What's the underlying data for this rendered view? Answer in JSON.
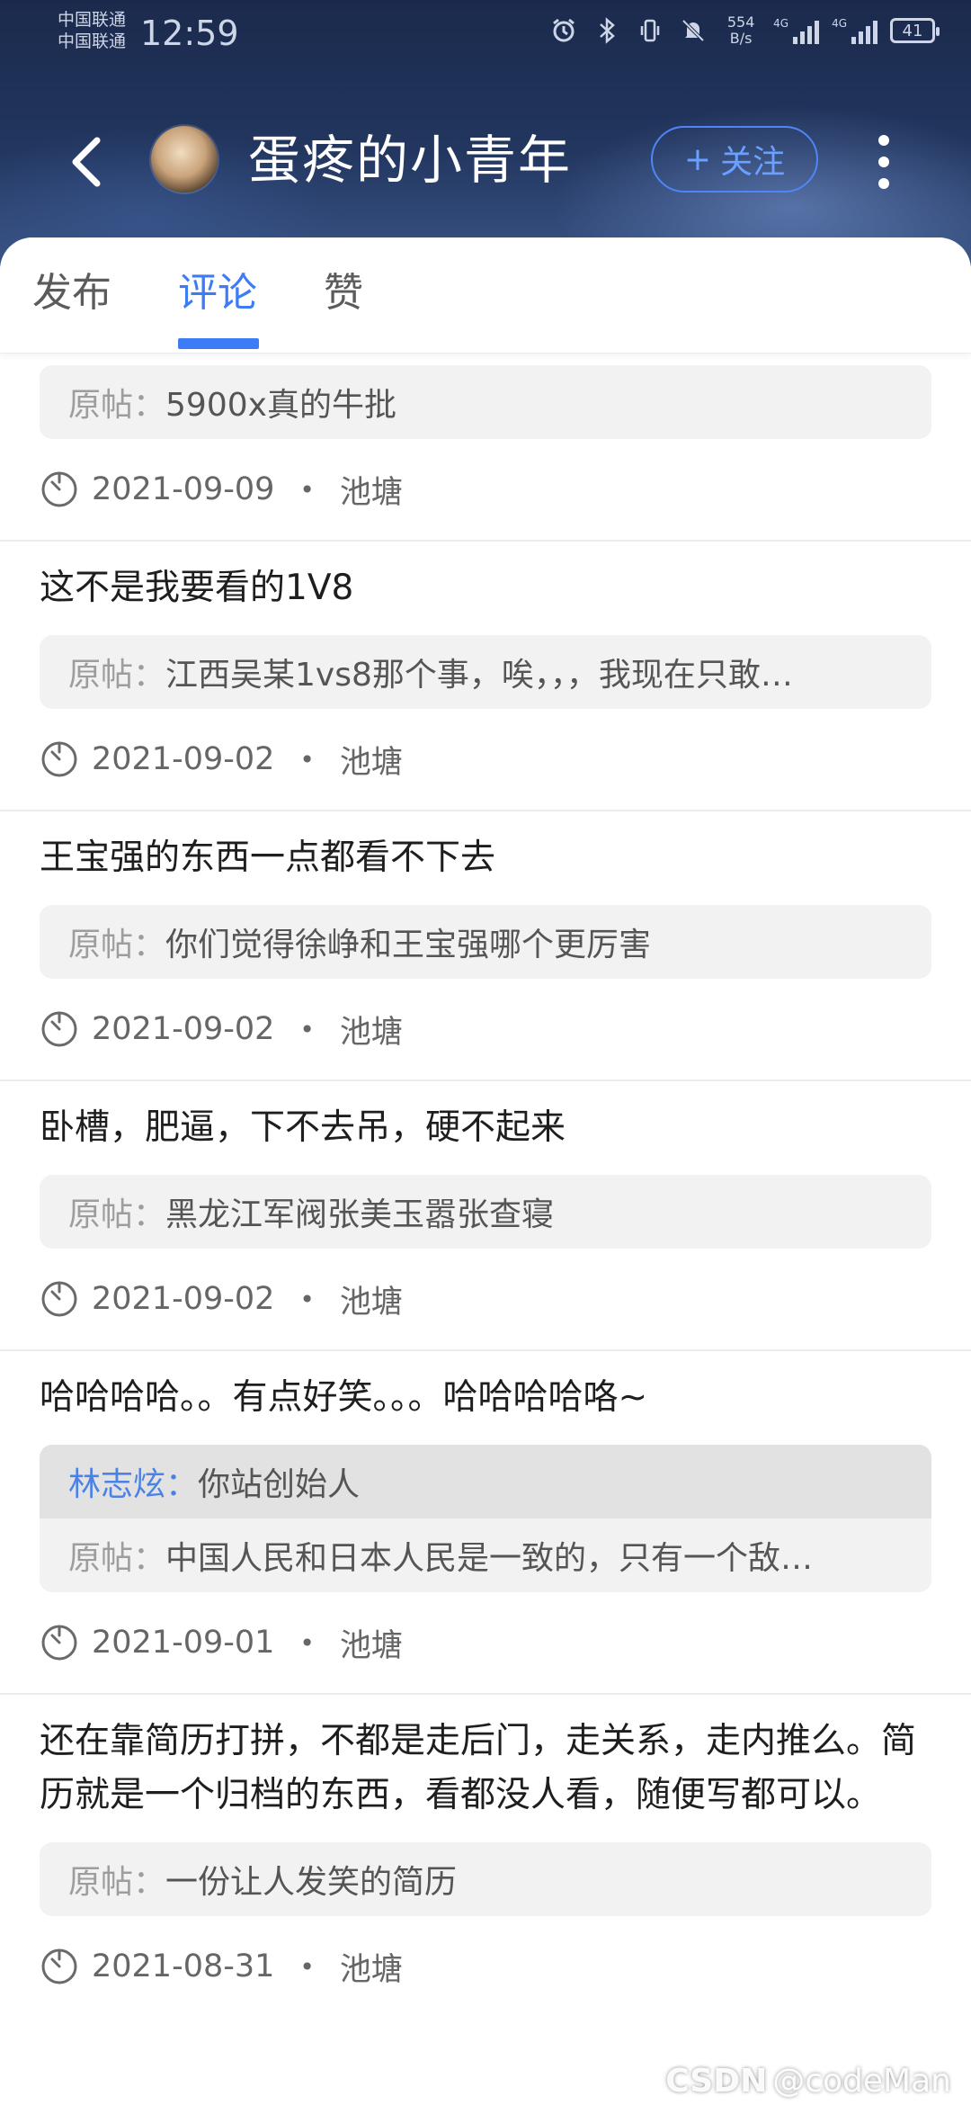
{
  "status_bar": {
    "carrier_1": "中国联通",
    "carrier_2": "中国联通",
    "time": "12:59",
    "net_speed_value": "554",
    "net_speed_unit": "B/s",
    "signal_1_label": "4G",
    "signal_2_label": "4G",
    "battery": "41"
  },
  "header": {
    "user_name": "蛋疼的小青年",
    "follow_label": "关注",
    "follow_plus": "+",
    "back_icon": "chevron-left-icon",
    "more_icon": "more-vertical-icon"
  },
  "tabs": [
    {
      "label": "发布"
    },
    {
      "label": "评论"
    },
    {
      "label": "赞"
    }
  ],
  "active_tab": "评论",
  "accent_color": "#3d7cf5",
  "feed": [
    {
      "text": "",
      "quote_prefix": "原帖：",
      "quote": "5900x真的牛批",
      "date": "2021-09-09",
      "category": "池塘"
    },
    {
      "text": "这不是我要看的1V8",
      "quote_prefix": "原帖：",
      "quote": "江西吴某1vs8那个事，唉，，，我现在只敢…",
      "date": "2021-09-02",
      "category": "池塘"
    },
    {
      "text": "王宝强的东西一点都看不下去",
      "quote_prefix": "原帖：",
      "quote": "你们觉得徐峥和王宝强哪个更厉害",
      "date": "2021-09-02",
      "category": "池塘"
    },
    {
      "text": "卧槽，肥逼，下不去吊，硬不起来",
      "quote_prefix": "原帖：",
      "quote": "黑龙江军阀张美玉嚣张查寝",
      "date": "2021-09-02",
      "category": "池塘"
    },
    {
      "text": "哈哈哈哈。。有点好笑。。。哈哈哈哈咯~",
      "reply_user": "林志炫：",
      "reply_text": "你站创始人",
      "quote_prefix": "原帖：",
      "quote": "中国人民和日本人民是一致的，只有一个敌…",
      "date": "2021-09-01",
      "category": "池塘"
    },
    {
      "text": "还在靠简历打拼，不都是走后门，走关系，走内推么。简历就是一个归档的东西，看都没人看，随便写都可以。",
      "quote_prefix": "原帖：",
      "quote": "一份让人发笑的简历",
      "date": "2021-08-31",
      "category": "池塘"
    }
  ],
  "separator": "•",
  "watermark": "@codeMan",
  "watermark_logo": "CSDN"
}
